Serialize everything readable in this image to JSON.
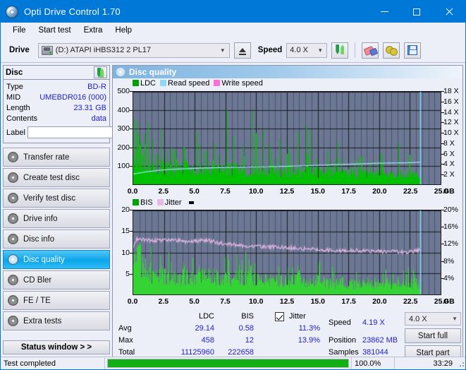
{
  "window": {
    "title": "Opti Drive Control 1.70",
    "icon": "disc-icon",
    "minimize": "–",
    "maximize": "□",
    "close": "✕"
  },
  "menu": {
    "items": [
      "File",
      "Start test",
      "Extra",
      "Help"
    ]
  },
  "toolbar": {
    "drive_label": "Drive",
    "drive_value": "(D:)   ATAPI iHBS312   2 PL17",
    "eject_tooltip": "Eject",
    "speed_label": "Speed",
    "speed_value": "4.0 X",
    "icons": [
      "refresh-icon",
      "eraser-icon",
      "plug-icon",
      "save-icon"
    ]
  },
  "disc_panel": {
    "title": "Disc",
    "refresh_icon": "refresh-icon",
    "rows": [
      {
        "key": "Type",
        "value": "BD-R"
      },
      {
        "key": "MID",
        "value": "UMEBDR016 (000)"
      },
      {
        "key": "Length",
        "value": "23.31 GB"
      },
      {
        "key": "Contents",
        "value": "data"
      }
    ],
    "label_key": "Label",
    "label_value": "",
    "label_placeholder": ""
  },
  "nav": {
    "items": [
      {
        "label": "Transfer rate",
        "icon": "disc-icon",
        "active": false
      },
      {
        "label": "Create test disc",
        "icon": "disc-icon",
        "active": false
      },
      {
        "label": "Verify test disc",
        "icon": "disc-icon",
        "active": false
      },
      {
        "label": "Drive info",
        "icon": "disc-icon",
        "active": false
      },
      {
        "label": "Disc info",
        "icon": "disc-icon",
        "active": false
      },
      {
        "label": "Disc quality",
        "icon": "disc-icon",
        "active": true
      },
      {
        "label": "CD Bler",
        "icon": "disc-icon",
        "active": false
      },
      {
        "label": "FE / TE",
        "icon": "disc-icon",
        "active": false
      },
      {
        "label": "Extra tests",
        "icon": "disc-icon",
        "active": false
      }
    ],
    "status_window": "Status window > >"
  },
  "panel": {
    "title": "Disc quality",
    "icon": "disc-icon"
  },
  "stats": {
    "col_headers": [
      "LDC",
      "BIS"
    ],
    "rows": [
      {
        "label": "Avg",
        "ldc": "29.14",
        "bis": "0.58",
        "jitter": "11.3%"
      },
      {
        "label": "Max",
        "ldc": "458",
        "bis": "12",
        "jitter": "13.9%"
      },
      {
        "label": "Total",
        "ldc": "11125960",
        "bis": "222658",
        "jitter": ""
      }
    ],
    "jitter_label": "Jitter",
    "jitter_checked": true,
    "speed_label": "Speed",
    "speed_value": "4.19 X",
    "position_label": "Position",
    "position_value": "23862 MB",
    "samples_label": "Samples",
    "samples_value": "381044",
    "speed_select": "4.0 X",
    "start_full": "Start full",
    "start_part": "Start part"
  },
  "statusbar": {
    "message": "Test completed",
    "progress_percent": 100.0,
    "progress_text": "100.0%",
    "elapsed": "33:29"
  },
  "chart_data": [
    {
      "id": "top",
      "type": "line",
      "title": "",
      "xlabel": "GB",
      "ylabel": "",
      "xlim": [
        0.0,
        25.0
      ],
      "xticks": [
        "0.0",
        "2.5",
        "5.0",
        "7.5",
        "10.0",
        "12.5",
        "15.0",
        "17.5",
        "20.0",
        "22.5",
        "25.0"
      ],
      "ylim": [
        0,
        500
      ],
      "yticks": [
        "100",
        "200",
        "300",
        "400",
        "500"
      ],
      "y2lim": [
        0,
        18
      ],
      "y2ticks": [
        "2 X",
        "4 X",
        "6 X",
        "8 X",
        "10 X",
        "12 X",
        "14 X",
        "16 X",
        "18 X"
      ],
      "y2label": "X",
      "legend": [
        {
          "name": "LDC",
          "color": "#00b000"
        },
        {
          "name": "Read speed",
          "color": "#8fd8f5"
        },
        {
          "name": "Write speed",
          "color": "#ff6fd8"
        }
      ],
      "legend_position": "top-left",
      "grid": true,
      "data_end_gb": 23.35,
      "series": [
        {
          "name": "LDC",
          "color": "#00c000",
          "kind": "spikes",
          "baseline": [
            {
              "gb": 0.0,
              "v": 165
            },
            {
              "gb": 0.5,
              "v": 150
            },
            {
              "gb": 1.0,
              "v": 130
            },
            {
              "gb": 2.0,
              "v": 110
            },
            {
              "gb": 3.0,
              "v": 100
            },
            {
              "gb": 5.0,
              "v": 92
            },
            {
              "gb": 7.5,
              "v": 88
            },
            {
              "gb": 10.0,
              "v": 82
            },
            {
              "gb": 12.5,
              "v": 78
            },
            {
              "gb": 15.0,
              "v": 72
            },
            {
              "gb": 17.5,
              "v": 66
            },
            {
              "gb": 20.0,
              "v": 62
            },
            {
              "gb": 22.5,
              "v": 58
            },
            {
              "gb": 23.35,
              "v": 55
            }
          ],
          "peaks": [
            {
              "gb": 0.05,
              "v": 370
            },
            {
              "gb": 0.3,
              "v": 300
            },
            {
              "gb": 0.55,
              "v": 270
            },
            {
              "gb": 0.95,
              "v": 255
            },
            {
              "gb": 1.2,
              "v": 345
            },
            {
              "gb": 1.55,
              "v": 250
            },
            {
              "gb": 2.25,
              "v": 335
            },
            {
              "gb": 3.35,
              "v": 225
            },
            {
              "gb": 4.1,
              "v": 240
            },
            {
              "gb": 5.15,
              "v": 310
            },
            {
              "gb": 5.95,
              "v": 200
            },
            {
              "gb": 6.6,
              "v": 230
            },
            {
              "gb": 7.55,
              "v": 455
            },
            {
              "gb": 8.1,
              "v": 290
            },
            {
              "gb": 8.95,
              "v": 215
            },
            {
              "gb": 9.7,
              "v": 420
            },
            {
              "gb": 9.95,
              "v": 330
            },
            {
              "gb": 10.55,
              "v": 295
            },
            {
              "gb": 11.05,
              "v": 240
            },
            {
              "gb": 11.85,
              "v": 275
            },
            {
              "gb": 12.55,
              "v": 215
            },
            {
              "gb": 13.35,
              "v": 305
            },
            {
              "gb": 14.05,
              "v": 325
            },
            {
              "gb": 14.45,
              "v": 290
            },
            {
              "gb": 15.75,
              "v": 205
            },
            {
              "gb": 16.55,
              "v": 260
            },
            {
              "gb": 18.55,
              "v": 180
            },
            {
              "gb": 20.15,
              "v": 200
            },
            {
              "gb": 21.55,
              "v": 235
            },
            {
              "gb": 22.45,
              "v": 190
            }
          ]
        },
        {
          "name": "Read speed",
          "color": "#a6e4fb",
          "kind": "line",
          "points": [
            {
              "gb": 0.0,
              "x": 2.0
            },
            {
              "gb": 1.0,
              "x": 2.4
            },
            {
              "gb": 2.0,
              "x": 2.7
            },
            {
              "gb": 3.0,
              "x": 2.9
            },
            {
              "gb": 5.0,
              "x": 3.1
            },
            {
              "gb": 7.5,
              "x": 3.3
            },
            {
              "gb": 10.0,
              "x": 3.4
            },
            {
              "gb": 12.5,
              "x": 3.5
            },
            {
              "gb": 15.0,
              "x": 3.7
            },
            {
              "gb": 17.5,
              "x": 3.9
            },
            {
              "gb": 20.0,
              "x": 4.1
            },
            {
              "gb": 22.5,
              "x": 4.2
            },
            {
              "gb": 23.35,
              "x": 4.3
            },
            {
              "gb": 23.4,
              "x": 18.0
            }
          ]
        }
      ]
    },
    {
      "id": "bottom",
      "type": "line",
      "title": "",
      "xlabel": "GB",
      "ylabel": "",
      "xlim": [
        0.0,
        25.0
      ],
      "xticks": [
        "0.0",
        "2.5",
        "5.0",
        "7.5",
        "10.0",
        "12.5",
        "15.0",
        "17.5",
        "20.0",
        "22.5",
        "25.0"
      ],
      "ylim": [
        0,
        20
      ],
      "yticks": [
        "5",
        "10",
        "15",
        "20"
      ],
      "y2lim": [
        0,
        20
      ],
      "y2ticks": [
        "4%",
        "8%",
        "12%",
        "16%",
        "20%"
      ],
      "legend": [
        {
          "name": "BIS",
          "color": "#00b000"
        },
        {
          "name": "Jitter",
          "color": "#e6b9e6"
        }
      ],
      "legend_position": "top-left",
      "grid": true,
      "data_end_gb": 23.35,
      "series": [
        {
          "name": "BIS",
          "color": "#35d435",
          "kind": "spikes",
          "baseline": [
            {
              "gb": 0.0,
              "v": 8.5
            },
            {
              "gb": 0.5,
              "v": 9.0
            },
            {
              "gb": 1.0,
              "v": 6.5
            },
            {
              "gb": 2.0,
              "v": 4.6
            },
            {
              "gb": 4.0,
              "v": 4.5
            },
            {
              "gb": 6.0,
              "v": 4.5
            },
            {
              "gb": 8.0,
              "v": 4.4
            },
            {
              "gb": 10.0,
              "v": 4.3
            },
            {
              "gb": 11.5,
              "v": 3.6
            },
            {
              "gb": 13.0,
              "v": 3.7
            },
            {
              "gb": 15.3,
              "v": 3.5
            },
            {
              "gb": 16.0,
              "v": 2.8
            },
            {
              "gb": 19.0,
              "v": 2.6
            },
            {
              "gb": 21.5,
              "v": 2.6
            },
            {
              "gb": 23.35,
              "v": 2.8
            }
          ],
          "peaks": [
            {
              "gb": 0.1,
              "v": 11.0
            },
            {
              "gb": 0.45,
              "v": 10.8
            },
            {
              "gb": 0.75,
              "v": 9.2
            },
            {
              "gb": 1.45,
              "v": 7.6
            },
            {
              "gb": 2.3,
              "v": 7.0
            },
            {
              "gb": 3.05,
              "v": 8.2
            },
            {
              "gb": 4.1,
              "v": 8.0
            },
            {
              "gb": 5.35,
              "v": 7.6
            },
            {
              "gb": 6.1,
              "v": 7.0
            },
            {
              "gb": 7.45,
              "v": 9.0
            },
            {
              "gb": 8.85,
              "v": 9.1
            },
            {
              "gb": 9.55,
              "v": 8.4
            },
            {
              "gb": 9.85,
              "v": 8.0
            },
            {
              "gb": 11.8,
              "v": 7.1
            },
            {
              "gb": 12.55,
              "v": 6.6
            },
            {
              "gb": 13.45,
              "v": 6.8
            },
            {
              "gb": 15.15,
              "v": 8.8
            },
            {
              "gb": 17.0,
              "v": 5.0
            },
            {
              "gb": 19.05,
              "v": 4.6
            },
            {
              "gb": 20.6,
              "v": 4.4
            },
            {
              "gb": 22.2,
              "v": 5.2
            },
            {
              "gb": 22.9,
              "v": 5.4
            }
          ]
        },
        {
          "name": "Jitter",
          "color": "#e3b6e3",
          "kind": "line",
          "points": [
            {
              "gb": 0.0,
              "v": 11.3
            },
            {
              "gb": 0.3,
              "v": 13.3
            },
            {
              "gb": 1.5,
              "v": 12.8
            },
            {
              "gb": 3.0,
              "v": 13.0
            },
            {
              "gb": 4.5,
              "v": 12.6
            },
            {
              "gb": 6.0,
              "v": 12.9
            },
            {
              "gb": 7.5,
              "v": 12.0
            },
            {
              "gb": 9.0,
              "v": 11.6
            },
            {
              "gb": 10.5,
              "v": 11.4
            },
            {
              "gb": 12.0,
              "v": 11.2
            },
            {
              "gb": 13.5,
              "v": 11.0
            },
            {
              "gb": 15.0,
              "v": 10.7
            },
            {
              "gb": 16.5,
              "v": 10.5
            },
            {
              "gb": 18.0,
              "v": 10.5
            },
            {
              "gb": 19.5,
              "v": 10.3
            },
            {
              "gb": 21.0,
              "v": 10.2
            },
            {
              "gb": 22.5,
              "v": 10.1
            },
            {
              "gb": 23.35,
              "v": 10.6
            }
          ]
        }
      ]
    }
  ]
}
